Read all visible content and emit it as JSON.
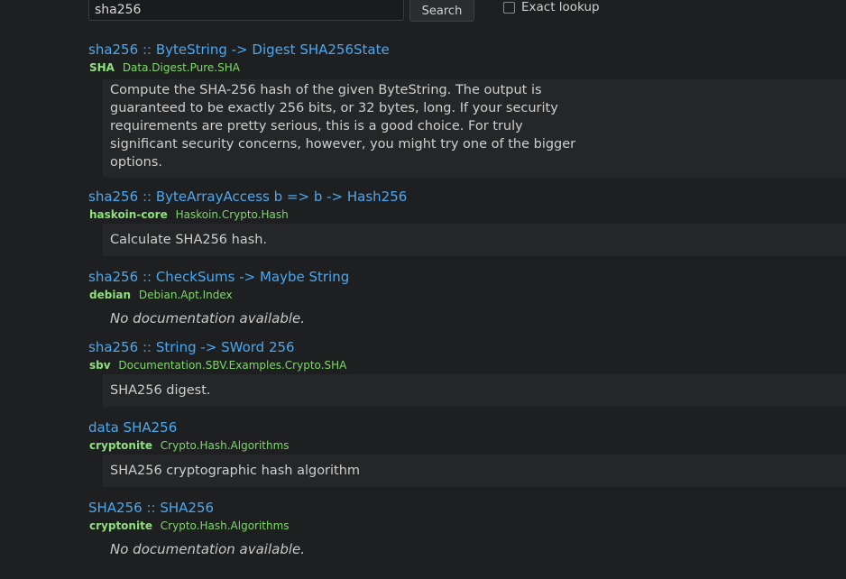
{
  "search": {
    "value": "sha256",
    "button_label": "Search",
    "exact_label": "Exact lookup",
    "exact_checked": false
  },
  "results": [
    {
      "name": "sha256",
      "sep": "::",
      "type": "ByteString -> Digest SHA256State",
      "package": "SHA",
      "module": "Data.Digest.Pure.SHA",
      "doc": "Compute the SHA-256 hash of the given ByteString. The output is guaranteed to be exactly 256 bits, or 32 bytes, long. If your security requirements are pretty serious, this is a good choice. For truly significant security concerns, however, you might try one of the bigger options."
    },
    {
      "name": "sha256",
      "sep": "::",
      "type": "ByteArrayAccess b => b -> Hash256",
      "package": "haskoin-core",
      "module": "Haskoin.Crypto.Hash",
      "doc": "Calculate SHA256 hash."
    },
    {
      "name": "sha256",
      "sep": "::",
      "type": "CheckSums -> Maybe String",
      "package": "debian",
      "module": "Debian.Apt.Index",
      "doc": "No documentation available."
    },
    {
      "name": "sha256",
      "sep": "::",
      "type": "String -> SWord 256",
      "package": "sbv",
      "module": "Documentation.SBV.Examples.Crypto.SHA",
      "doc": "SHA256 digest."
    },
    {
      "name": "data SHA256",
      "sep": "",
      "type": "",
      "package": "cryptonite",
      "module": "Crypto.Hash.Algorithms",
      "doc": "SHA256 cryptographic hash algorithm"
    },
    {
      "name": "SHA256",
      "sep": "::",
      "type": "SHA256",
      "package": "cryptonite",
      "module": "Crypto.Hash.Algorithms",
      "doc": "No documentation available."
    }
  ]
}
